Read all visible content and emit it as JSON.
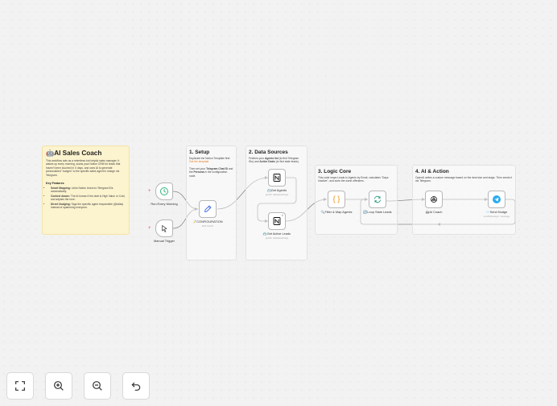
{
  "main_note": {
    "title": "🤖AI Sales Coach",
    "intro": "This workflow acts as a relentless but helpful sales manager. It wakes up every morning, scans your Notion CRM for leads that haven't been touched in X days, and uses AI to generate personalized \"nudges\" to the specific sales agent in charge via Telegram.",
    "features_heading": "Key Features",
    "features": [
      {
        "bold": "Smart Mapping:",
        "text": " Links Notion Users to Telegram IDs automatically."
      },
      {
        "bold": "Context Aware:",
        "text": " The AI knows if the deal is High Value or Cold, and adjusts the tone."
      },
      {
        "bold": "Direct Nudging:",
        "text": " Tags the specific agent responsible (@alias) instead of spamming everyone."
      }
    ]
  },
  "sections": {
    "setup": {
      "title": "1. Setup",
      "line1_a": "Duplicate the Notion Template first:",
      "line1_link": "Get the template",
      "line2_a": "Then set your ",
      "line2_b": "Telegram Chat ID",
      "line2_c": " and the ",
      "line2_d": "Persona",
      "line2_e": " in the configuration node."
    },
    "data_sources": {
      "title": "2. Data Sources",
      "line_a": "Fetches your ",
      "line_b": "Agents list",
      "line_c": " (to find Telegram IDs) and ",
      "line_d": "Active Deals",
      "line_e": " (to find stale leads)."
    },
    "logic_core": {
      "title": "3. Logic Core",
      "text": "This code maps Leads to Agents by Email, calculates \"Days Inactive\", and sorts the worst offenders."
    },
    "ai_action": {
      "title": "4. AI & Action",
      "text": "OpenAI writes a custom message based on the deal size and stage. Then sends it via Telegram."
    }
  },
  "nodes": {
    "run_every_morning": {
      "label": "Run Every Morning"
    },
    "manual_trigger": {
      "label": "Manual Trigger"
    },
    "configuration": {
      "label": "📝CONFIGURATION",
      "sub": "Edit Fields"
    },
    "get_agents": {
      "label": "📇Get Agents",
      "sub": "getAll: databasePage"
    },
    "get_active_leads": {
      "label": "📇Get Active Leads",
      "sub": "getAll: databasePage",
      "badge": "1"
    },
    "filter_map_agents": {
      "label": "🔍Filter & Map Agents"
    },
    "loop_stale_leads": {
      "label": "🔄Loop Stale Leads"
    },
    "ai_coach": {
      "label": "🤖AI Coach"
    },
    "send_nudge": {
      "label": "📨Send Nudge",
      "sub": "sendMessage: message"
    }
  },
  "controls": {
    "fit_view": "fit-view",
    "zoom_in": "zoom-in",
    "zoom_out": "zoom-out",
    "undo": "undo"
  },
  "colors": {
    "sticky_yellow": "#fcf3cf",
    "link_orange": "#e67e22",
    "trigger_green": "#2eb67d",
    "notion_black": "#111111",
    "code_orange": "#f0a030",
    "loop_green": "#2b9e7f",
    "telegram_blue": "#2aabee",
    "pen_blue": "#4a6fe8",
    "edge_gray": "#8a8a8a"
  }
}
